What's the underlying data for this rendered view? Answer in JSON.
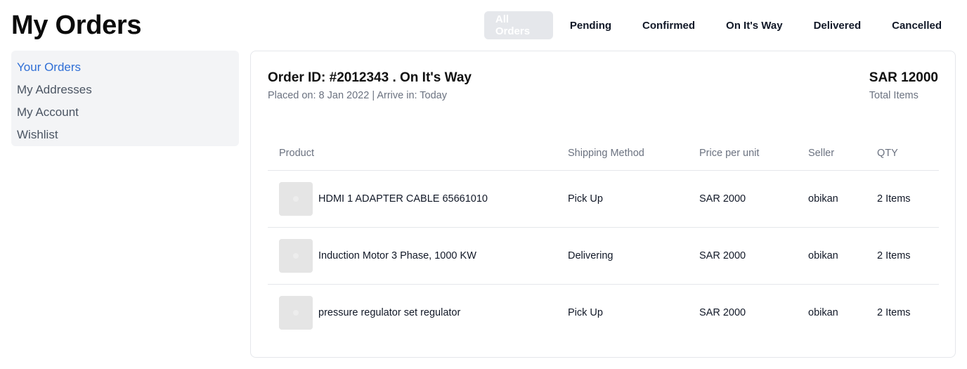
{
  "page": {
    "title": "My Orders"
  },
  "tabs": [
    {
      "label": "All Orders",
      "active": true
    },
    {
      "label": "Pending"
    },
    {
      "label": "Confirmed"
    },
    {
      "label": "On It's Way"
    },
    {
      "label": "Delivered"
    },
    {
      "label": "Cancelled"
    }
  ],
  "sidebar": {
    "items": [
      {
        "label": "Your Orders",
        "active": true
      },
      {
        "label": "My Addresses"
      },
      {
        "label": "My Account"
      },
      {
        "label": "Wishlist"
      }
    ]
  },
  "order": {
    "title": "Order ID: #2012343 . On It's Way",
    "subtitle": "Placed on: 8 Jan 2022 | Arrive in: Today",
    "total_amount": "SAR 12000",
    "total_label": "Total Items",
    "columns": [
      "Product",
      "Shipping Method",
      "Price per unit",
      "Seller",
      "QTY"
    ],
    "items": [
      {
        "product": "HDMI 1 ADAPTER CABLE 65661010",
        "shipping": "Pick Up",
        "price": "SAR 2000",
        "seller": "obikan",
        "qty": "2 Items"
      },
      {
        "product": "Induction Motor 3 Phase, 1000 KW",
        "shipping": "Delivering",
        "price": "SAR 2000",
        "seller": "obikan",
        "qty": "2 Items"
      },
      {
        "product": "pressure regulator set regulator",
        "shipping": "Pick Up",
        "price": "SAR 2000",
        "seller": "obikan",
        "qty": "2 Items"
      }
    ]
  },
  "colors": {
    "link_active": "#2f6fd6",
    "muted": "#6b7280",
    "panel_bg": "#f3f4f6",
    "tab_active_bg": "#e5e7eb"
  },
  "icons": {
    "product_thumbnail": "product-thumbnail-icon"
  }
}
